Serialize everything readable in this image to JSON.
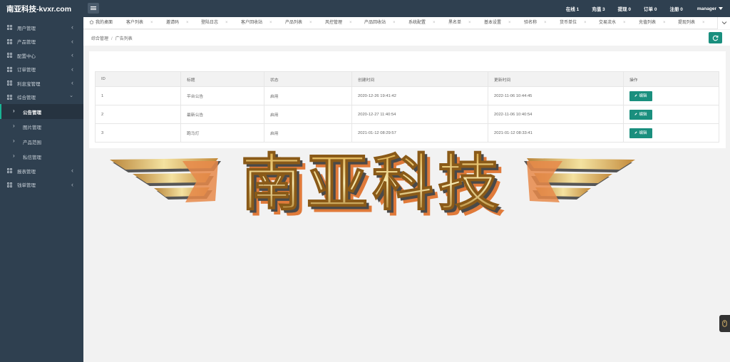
{
  "header": {
    "brand": "南亚科技-kvxr.com",
    "stats": [
      {
        "label": "在线 1"
      },
      {
        "label": "充值 3"
      },
      {
        "label": "提现 0"
      },
      {
        "label": "订单 0"
      },
      {
        "label": "注册 0"
      }
    ],
    "user": "manager"
  },
  "sidebar": {
    "items": [
      {
        "label": "用户管理"
      },
      {
        "label": "产品管理"
      },
      {
        "label": "配置中心"
      },
      {
        "label": "订单管理"
      },
      {
        "label": "利息宝管理"
      },
      {
        "label": "综合管理"
      }
    ],
    "subitems": [
      {
        "label": "公告管理"
      },
      {
        "label": "图片管理"
      },
      {
        "label": "产品范围"
      },
      {
        "label": "私信管理"
      }
    ],
    "items_after": [
      {
        "label": "报表管理"
      },
      {
        "label": "钱单管理"
      }
    ]
  },
  "tabs": [
    {
      "label": "我的桌面"
    },
    {
      "label": "客户列表"
    },
    {
      "label": "邀请码"
    },
    {
      "label": "登陆日志"
    },
    {
      "label": "客户回收站"
    },
    {
      "label": "产品列表"
    },
    {
      "label": "风控管理"
    },
    {
      "label": "产品回收站"
    },
    {
      "label": "系统配置"
    },
    {
      "label": "黑名单"
    },
    {
      "label": "基本设置"
    },
    {
      "label": "验名称"
    },
    {
      "label": "货币单位"
    },
    {
      "label": "交易流水"
    },
    {
      "label": "充值列表"
    },
    {
      "label": "提现列表"
    }
  ],
  "breadcrumb": {
    "parent": "综合管理",
    "separator": "/",
    "current": "广告列表"
  },
  "table": {
    "headers": [
      "ID",
      "标题",
      "状态",
      "创建时间",
      "更新时间",
      "操作"
    ],
    "rows": [
      {
        "id": "1",
        "title": "平台公告",
        "status": "启用",
        "created": "2020-12-26 19:41:42",
        "updated": "2022-11-06 10:44:45",
        "action": "编辑"
      },
      {
        "id": "2",
        "title": "最新公告",
        "status": "启用",
        "created": "2020-12-27 11:40:54",
        "updated": "2022-11-06 10:40:54",
        "action": "编辑"
      },
      {
        "id": "3",
        "title": "跑马灯",
        "status": "启用",
        "created": "2021-01-12 08:29:57",
        "updated": "2021-01-12 08:33:41",
        "action": "编辑"
      }
    ]
  },
  "banner": {
    "text": "南亚科技"
  },
  "colors": {
    "primary": "#1a8f7e",
    "sidebar": "#2f4050",
    "accent": "#1ab394"
  },
  "icons": [
    "menu-icon",
    "grid-icon",
    "chevron-left-icon",
    "chevron-down-icon",
    "chevron-right-icon",
    "home-icon",
    "close-icon",
    "refresh-icon",
    "pencil-icon",
    "support-icon"
  ]
}
